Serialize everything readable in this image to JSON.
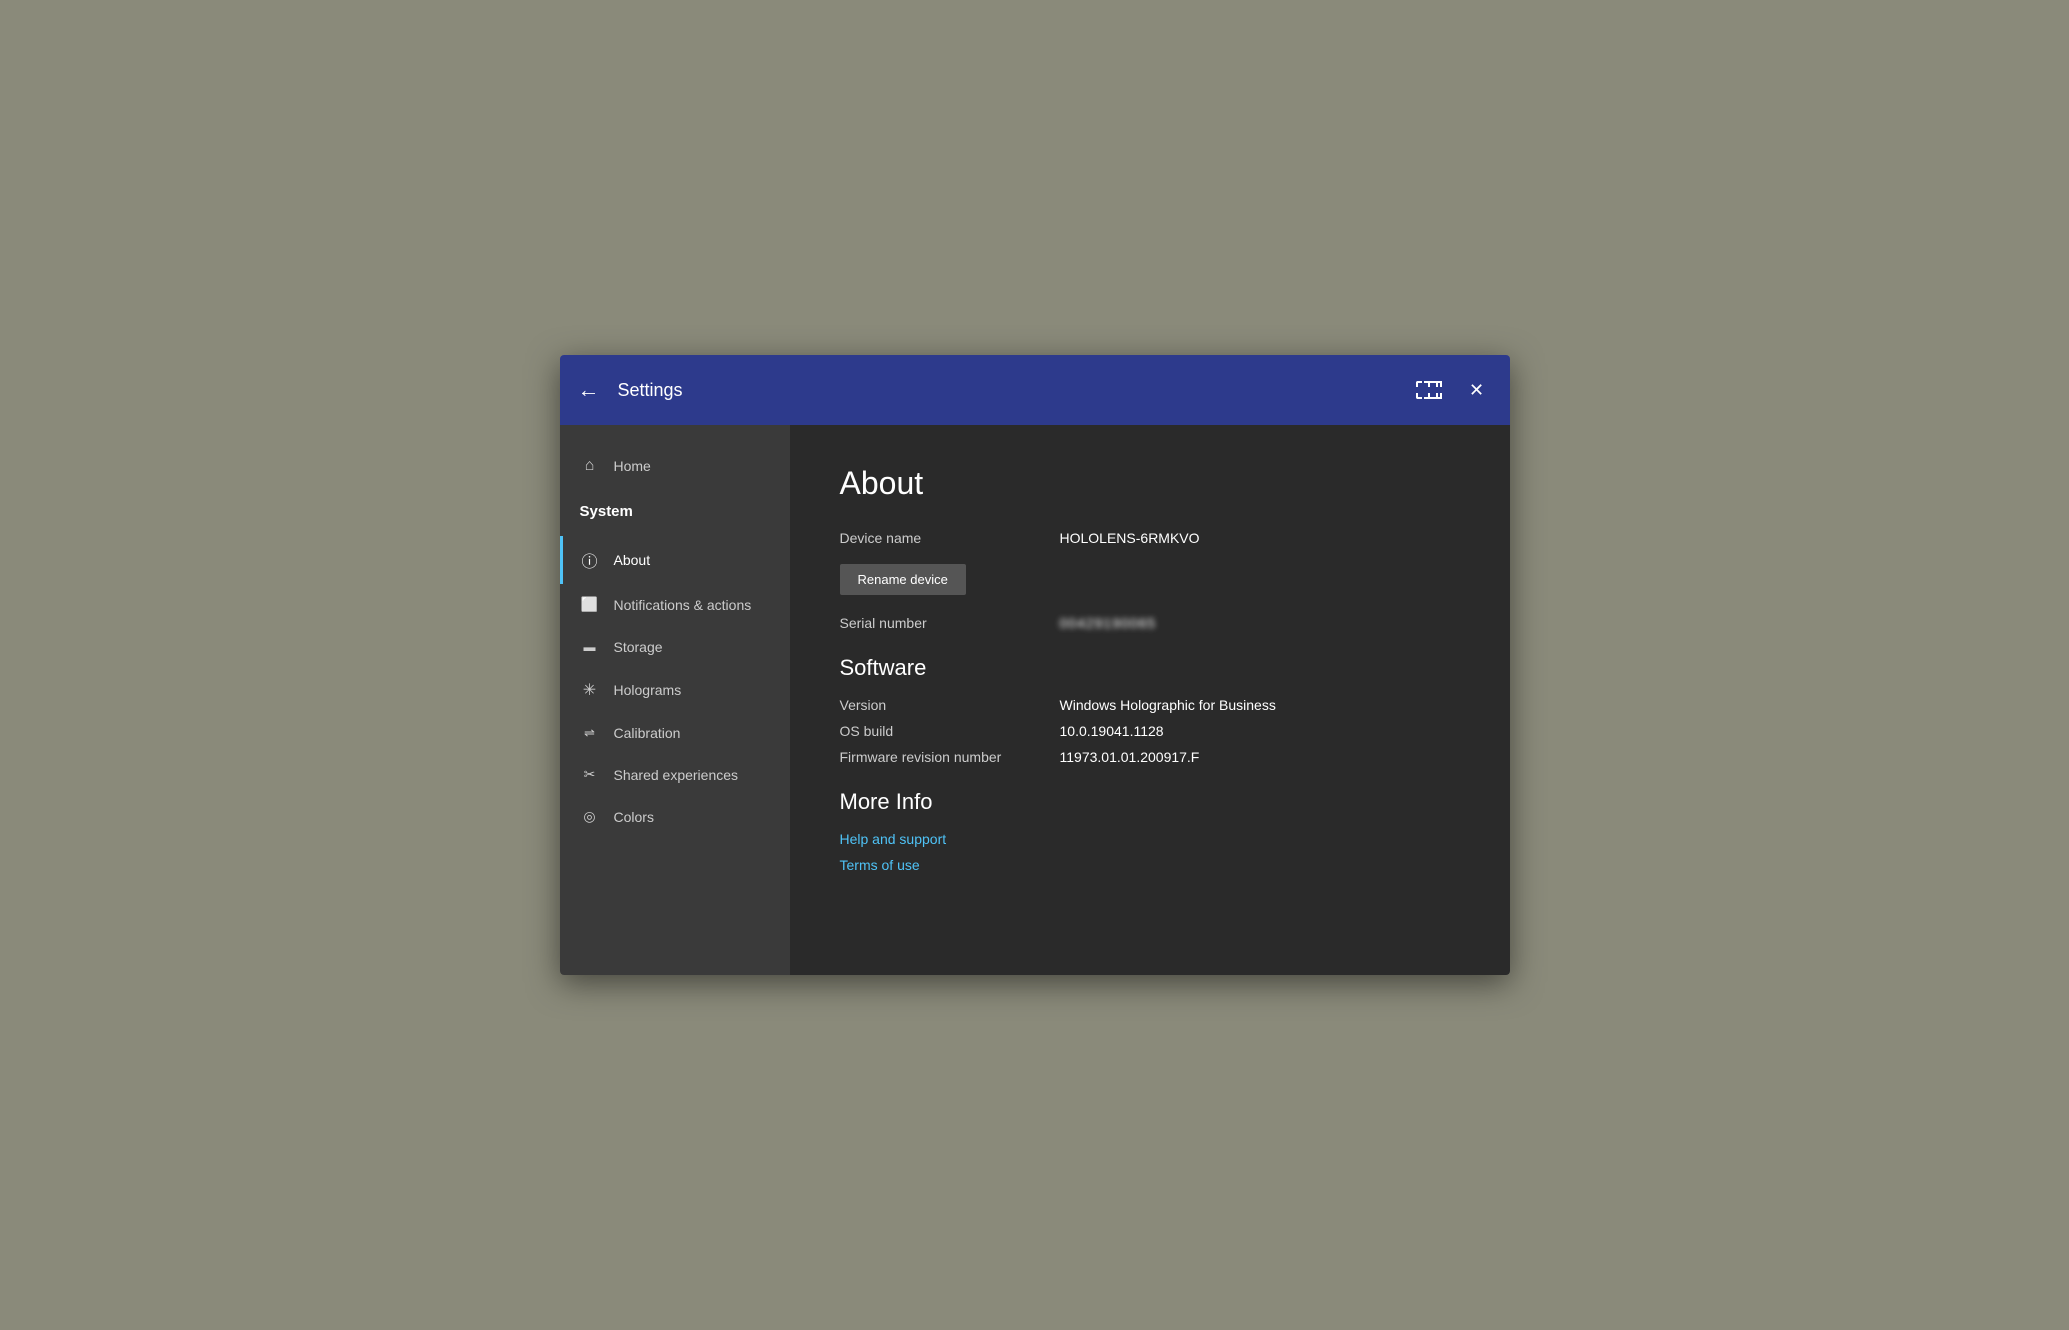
{
  "titlebar": {
    "title": "Settings",
    "back_label": "←",
    "close_label": "✕"
  },
  "sidebar": {
    "items": [
      {
        "id": "home",
        "label": "Home",
        "icon": "home",
        "type": "item"
      },
      {
        "id": "system",
        "label": "System",
        "icon": null,
        "type": "header"
      },
      {
        "id": "about",
        "label": "About",
        "icon": "about",
        "type": "item",
        "active": true
      },
      {
        "id": "notifications",
        "label": "Notifications & actions",
        "icon": "notifications",
        "type": "item"
      },
      {
        "id": "storage",
        "label": "Storage",
        "icon": "storage",
        "type": "item"
      },
      {
        "id": "holograms",
        "label": "Holograms",
        "icon": "holograms",
        "type": "item"
      },
      {
        "id": "calibration",
        "label": "Calibration",
        "icon": "calibration",
        "type": "item"
      },
      {
        "id": "shared",
        "label": "Shared experiences",
        "icon": "shared",
        "type": "item"
      },
      {
        "id": "colors",
        "label": "Colors",
        "icon": "colors",
        "type": "item"
      }
    ]
  },
  "main": {
    "page_title": "About",
    "device_name_label": "Device name",
    "device_name_value": "HOLOLENS-6RMKVO",
    "rename_btn_label": "Rename device",
    "serial_number_label": "Serial number",
    "serial_number_value": "00429190065",
    "software_section_title": "Software",
    "version_label": "Version",
    "version_value": "Windows Holographic for Business",
    "os_build_label": "OS build",
    "os_build_value": "10.0.19041.1128",
    "firmware_label": "Firmware revision number",
    "firmware_value": "11973.01.01.200917.F",
    "more_info_section_title": "More Info",
    "help_support_link": "Help and support",
    "terms_link": "Terms of use"
  }
}
